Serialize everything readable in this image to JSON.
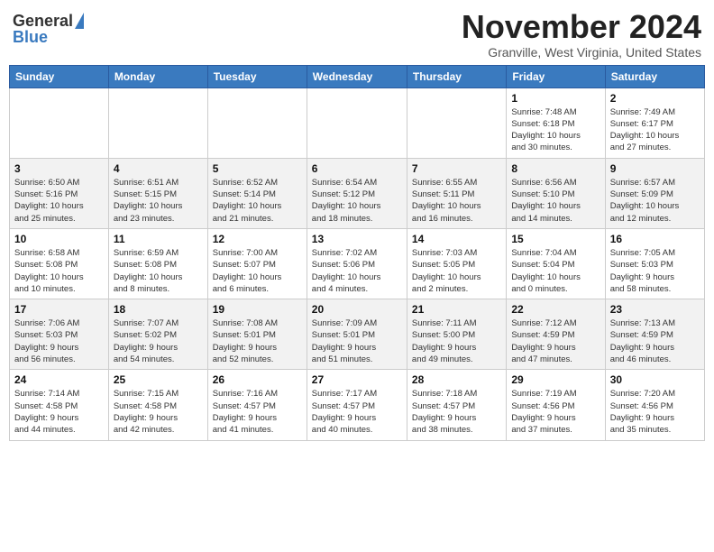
{
  "logo": {
    "general": "General",
    "blue": "Blue"
  },
  "title": "November 2024",
  "location": "Granville, West Virginia, United States",
  "weekdays": [
    "Sunday",
    "Monday",
    "Tuesday",
    "Wednesday",
    "Thursday",
    "Friday",
    "Saturday"
  ],
  "weeks": [
    [
      {
        "day": "",
        "info": ""
      },
      {
        "day": "",
        "info": ""
      },
      {
        "day": "",
        "info": ""
      },
      {
        "day": "",
        "info": ""
      },
      {
        "day": "",
        "info": ""
      },
      {
        "day": "1",
        "info": "Sunrise: 7:48 AM\nSunset: 6:18 PM\nDaylight: 10 hours\nand 30 minutes."
      },
      {
        "day": "2",
        "info": "Sunrise: 7:49 AM\nSunset: 6:17 PM\nDaylight: 10 hours\nand 27 minutes."
      }
    ],
    [
      {
        "day": "3",
        "info": "Sunrise: 6:50 AM\nSunset: 5:16 PM\nDaylight: 10 hours\nand 25 minutes."
      },
      {
        "day": "4",
        "info": "Sunrise: 6:51 AM\nSunset: 5:15 PM\nDaylight: 10 hours\nand 23 minutes."
      },
      {
        "day": "5",
        "info": "Sunrise: 6:52 AM\nSunset: 5:14 PM\nDaylight: 10 hours\nand 21 minutes."
      },
      {
        "day": "6",
        "info": "Sunrise: 6:54 AM\nSunset: 5:12 PM\nDaylight: 10 hours\nand 18 minutes."
      },
      {
        "day": "7",
        "info": "Sunrise: 6:55 AM\nSunset: 5:11 PM\nDaylight: 10 hours\nand 16 minutes."
      },
      {
        "day": "8",
        "info": "Sunrise: 6:56 AM\nSunset: 5:10 PM\nDaylight: 10 hours\nand 14 minutes."
      },
      {
        "day": "9",
        "info": "Sunrise: 6:57 AM\nSunset: 5:09 PM\nDaylight: 10 hours\nand 12 minutes."
      }
    ],
    [
      {
        "day": "10",
        "info": "Sunrise: 6:58 AM\nSunset: 5:08 PM\nDaylight: 10 hours\nand 10 minutes."
      },
      {
        "day": "11",
        "info": "Sunrise: 6:59 AM\nSunset: 5:08 PM\nDaylight: 10 hours\nand 8 minutes."
      },
      {
        "day": "12",
        "info": "Sunrise: 7:00 AM\nSunset: 5:07 PM\nDaylight: 10 hours\nand 6 minutes."
      },
      {
        "day": "13",
        "info": "Sunrise: 7:02 AM\nSunset: 5:06 PM\nDaylight: 10 hours\nand 4 minutes."
      },
      {
        "day": "14",
        "info": "Sunrise: 7:03 AM\nSunset: 5:05 PM\nDaylight: 10 hours\nand 2 minutes."
      },
      {
        "day": "15",
        "info": "Sunrise: 7:04 AM\nSunset: 5:04 PM\nDaylight: 10 hours\nand 0 minutes."
      },
      {
        "day": "16",
        "info": "Sunrise: 7:05 AM\nSunset: 5:03 PM\nDaylight: 9 hours\nand 58 minutes."
      }
    ],
    [
      {
        "day": "17",
        "info": "Sunrise: 7:06 AM\nSunset: 5:03 PM\nDaylight: 9 hours\nand 56 minutes."
      },
      {
        "day": "18",
        "info": "Sunrise: 7:07 AM\nSunset: 5:02 PM\nDaylight: 9 hours\nand 54 minutes."
      },
      {
        "day": "19",
        "info": "Sunrise: 7:08 AM\nSunset: 5:01 PM\nDaylight: 9 hours\nand 52 minutes."
      },
      {
        "day": "20",
        "info": "Sunrise: 7:09 AM\nSunset: 5:01 PM\nDaylight: 9 hours\nand 51 minutes."
      },
      {
        "day": "21",
        "info": "Sunrise: 7:11 AM\nSunset: 5:00 PM\nDaylight: 9 hours\nand 49 minutes."
      },
      {
        "day": "22",
        "info": "Sunrise: 7:12 AM\nSunset: 4:59 PM\nDaylight: 9 hours\nand 47 minutes."
      },
      {
        "day": "23",
        "info": "Sunrise: 7:13 AM\nSunset: 4:59 PM\nDaylight: 9 hours\nand 46 minutes."
      }
    ],
    [
      {
        "day": "24",
        "info": "Sunrise: 7:14 AM\nSunset: 4:58 PM\nDaylight: 9 hours\nand 44 minutes."
      },
      {
        "day": "25",
        "info": "Sunrise: 7:15 AM\nSunset: 4:58 PM\nDaylight: 9 hours\nand 42 minutes."
      },
      {
        "day": "26",
        "info": "Sunrise: 7:16 AM\nSunset: 4:57 PM\nDaylight: 9 hours\nand 41 minutes."
      },
      {
        "day": "27",
        "info": "Sunrise: 7:17 AM\nSunset: 4:57 PM\nDaylight: 9 hours\nand 40 minutes."
      },
      {
        "day": "28",
        "info": "Sunrise: 7:18 AM\nSunset: 4:57 PM\nDaylight: 9 hours\nand 38 minutes."
      },
      {
        "day": "29",
        "info": "Sunrise: 7:19 AM\nSunset: 4:56 PM\nDaylight: 9 hours\nand 37 minutes."
      },
      {
        "day": "30",
        "info": "Sunrise: 7:20 AM\nSunset: 4:56 PM\nDaylight: 9 hours\nand 35 minutes."
      }
    ]
  ]
}
